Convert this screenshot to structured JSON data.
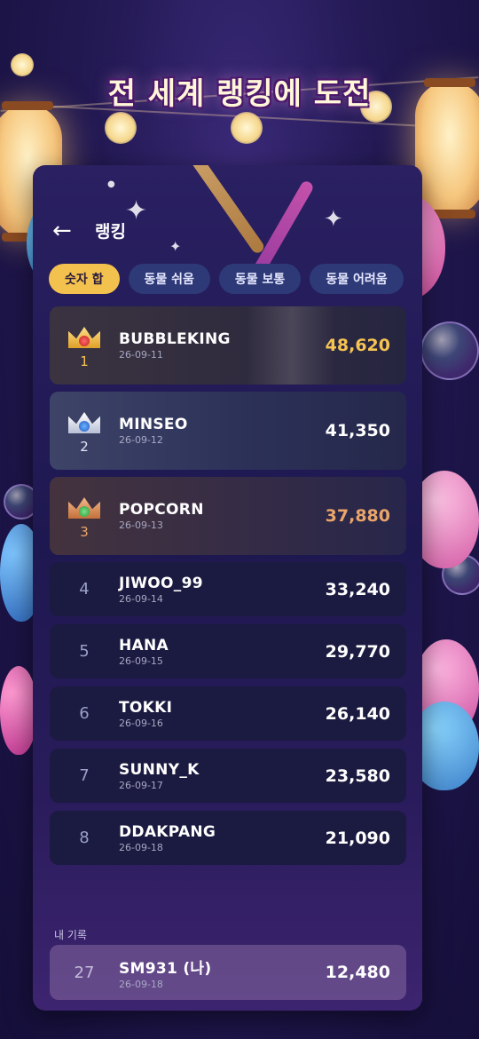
{
  "page_title": "전 세계 랭킹에 도전",
  "header": {
    "back_icon": "←",
    "title": "랭킹"
  },
  "tabs": [
    {
      "label": "숫자 합",
      "active": true
    },
    {
      "label": "동물 쉬움",
      "active": false
    },
    {
      "label": "동물 보통",
      "active": false
    },
    {
      "label": "동물 어려움",
      "active": false
    }
  ],
  "rankings": [
    {
      "rank": "1",
      "name": "BUBBLEKING",
      "date": "26-09-11",
      "score": "48,620",
      "medal": "gold"
    },
    {
      "rank": "2",
      "name": "MINSEO",
      "date": "26-09-12",
      "score": "41,350",
      "medal": "silver"
    },
    {
      "rank": "3",
      "name": "POPCORN",
      "date": "26-09-13",
      "score": "37,880",
      "medal": "bronze"
    },
    {
      "rank": "4",
      "name": "JIWOO_99",
      "date": "26-09-14",
      "score": "33,240"
    },
    {
      "rank": "5",
      "name": "HANA",
      "date": "26-09-15",
      "score": "29,770"
    },
    {
      "rank": "6",
      "name": "TOKKI",
      "date": "26-09-16",
      "score": "26,140"
    },
    {
      "rank": "7",
      "name": "SUNNY_K",
      "date": "26-09-17",
      "score": "23,580"
    },
    {
      "rank": "8",
      "name": "DDAKPANG",
      "date": "26-09-18",
      "score": "21,090"
    }
  ],
  "my_record": {
    "label": "내 기록",
    "rank": "27",
    "name": "SM931 (나)",
    "date": "26-09-18",
    "score": "12,480"
  },
  "colors": {
    "accent_gold": "#f2c14e",
    "tab_bg": "#2e3a78",
    "score_gold": "#f6c453",
    "score_bronze": "#eaa56a"
  }
}
